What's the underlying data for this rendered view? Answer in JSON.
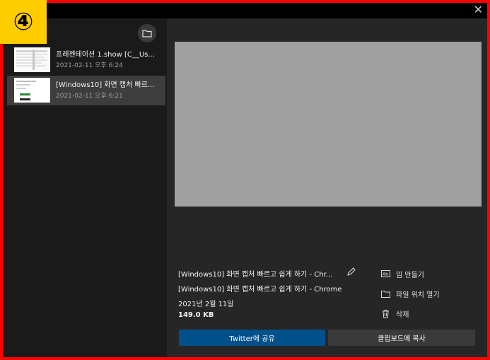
{
  "badge": {
    "label": "④",
    "color": "#ffcc00"
  },
  "window": {
    "close_glyph": "✕"
  },
  "sidebar": {
    "folder_icon": "folder-icon",
    "items": [
      {
        "title": "프레젠테이션 1.show [C__Us...",
        "date": "2021-02-11 오후 6:24",
        "selected": false
      },
      {
        "title": "[Windows10] 화면 캡처 빠르...",
        "date": "2021-02-11 오후 6:21",
        "selected": true
      }
    ]
  },
  "details": {
    "file_name": "[Windows10] 화면 캡처 빠르고 쉽게 하기 - Chr...",
    "page_title": "[Windows10] 화면 캡처 빠르고 쉽게 하기 - Chrome",
    "date": "2021년 2월 11일",
    "size": "149.0 KB"
  },
  "actions": [
    {
      "label": "밈 만들기",
      "icon": "meme-icon"
    },
    {
      "label": "파일 위치 열기",
      "icon": "folder-icon"
    },
    {
      "label": "삭제",
      "icon": "trash-icon"
    }
  ],
  "buttons": {
    "share": "Twitter에 공유",
    "copy": "클립보드에 복사"
  },
  "colors": {
    "border": "#ff0000",
    "share_button": "#00508c",
    "preview": "#a0a0a0"
  }
}
